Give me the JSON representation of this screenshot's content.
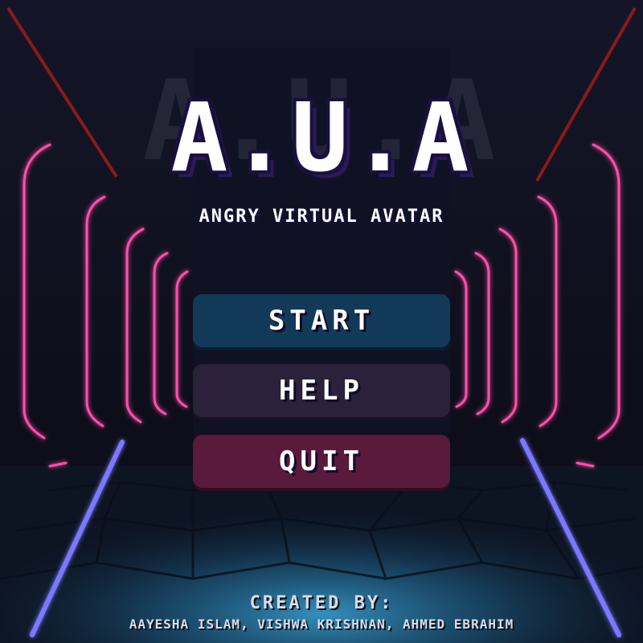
{
  "game": {
    "title": "A.U.A",
    "subtitle": "ANGRY VIRTUAL AVATAR"
  },
  "menu": {
    "start_label": "START",
    "help_label": "HELP",
    "quit_label": "QUIT"
  },
  "credits": {
    "heading": "CREATED BY:",
    "names": "AAYESHA ISLAM, VISHWA KRISHNAN, AHMED EBRAHIM"
  },
  "colors": {
    "start_button": "#123a58",
    "help_button": "#2b213a",
    "quit_button": "#5a1a3c",
    "neon_pink": "#ff4fa8",
    "neon_blue": "#7b78ff",
    "laser_red": "#8a1a1a",
    "floor_glow": "#3aa6d8"
  }
}
